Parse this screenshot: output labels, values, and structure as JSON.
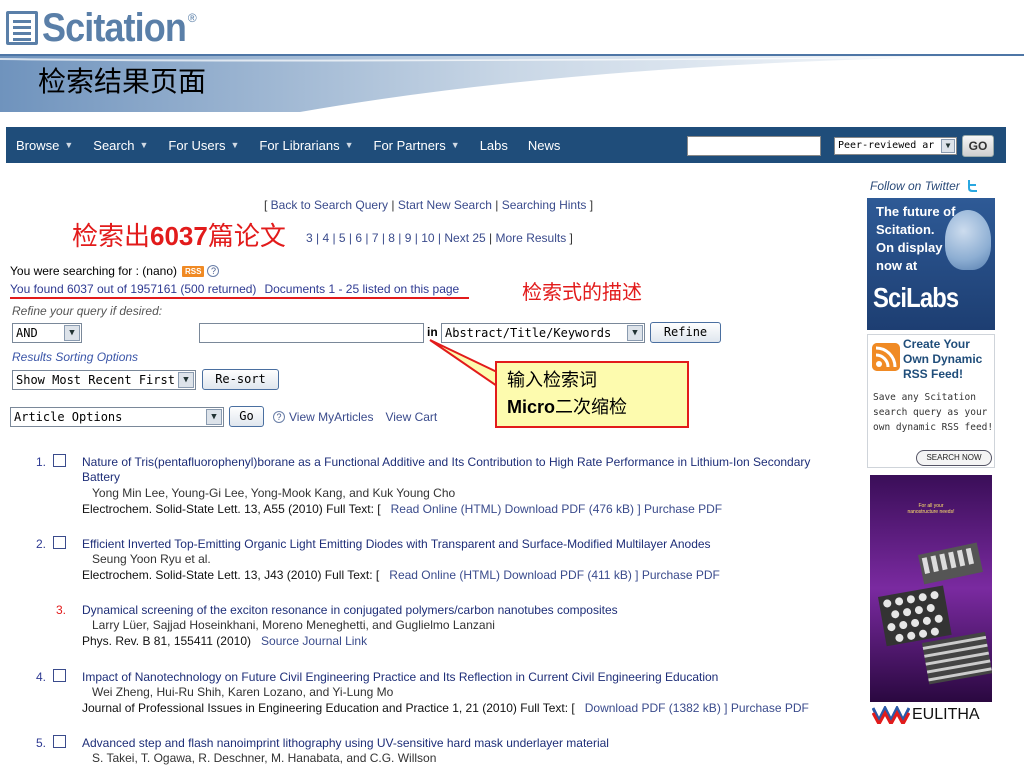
{
  "slide": {
    "logo_text": "Scitation",
    "logo_reg": "®",
    "title": "检索结果页面",
    "anno_found_prefix": "检索出",
    "anno_found_num": "6037",
    "anno_found_suffix": "篇论文",
    "anno_desc": "检索式的描述",
    "callout_line1": "输入检索词",
    "callout_line2_a": "Micro",
    "callout_line2_b": "二次缩检",
    "accent_color": "#e21b1b"
  },
  "navbar": {
    "items": [
      {
        "label": "Browse",
        "caret": true
      },
      {
        "label": "Search",
        "caret": true
      },
      {
        "label": "For Users",
        "caret": true
      },
      {
        "label": "For Librarians",
        "caret": true
      },
      {
        "label": "For Partners",
        "caret": true
      },
      {
        "label": "Labs",
        "caret": false
      },
      {
        "label": "News",
        "caret": false
      }
    ],
    "search_value": "",
    "scope_select": "Peer-reviewed ar",
    "go_label": "GO",
    "bg_color": "#1f4d7a"
  },
  "toplinks": {
    "open": "[ ",
    "back": "Back to Search Query",
    "start": "Start New Search",
    "hints": "Searching Hints",
    "close": " ]"
  },
  "pagelinks": {
    "visible": "3 | 4 | 5 | 6 | 7 | 8 | 9 | 10 | ",
    "next": "Next 25",
    "more": "More Results",
    "close": " ]"
  },
  "search_info": {
    "searching_for": "You were searching for : (nano)",
    "rss": "RSS",
    "help": "?",
    "found": "You found 6037 out of 1957161 (500 returned)",
    "docs": "Documents 1 - 25 listed on this page",
    "refine_label": "Refine your query if desired:",
    "bool_select": "AND",
    "refine_value": "",
    "in_label": "in",
    "field_select": "Abstract/Title/Keywords",
    "refine_btn": "Refine",
    "sort_label": "Results Sorting Options",
    "sort_select": "Show Most Recent First",
    "resort_btn": "Re-sort",
    "article_select": "Article Options",
    "go_btn": "Go",
    "view_myarticles": "View MyArticles",
    "view_cart": "View Cart"
  },
  "results": [
    {
      "num": "1.",
      "checkbox": true,
      "title": "Nature of Tris(pentafluorophenyl)borane as a Functional Additive and Its Contribution to High Rate Performance in Lithium-Ion Secondary Battery",
      "authors": "Yong Min Lee, Young-Gi Lee, Yong-Mook Kang, and Kuk Young Cho",
      "cite": "Electrochem. Solid-State Lett. 13, A55 (2010)  Full Text: [",
      "links": "Read Online (HTML)   Download PDF (476 kB) ]   Purchase PDF"
    },
    {
      "num": "2.",
      "checkbox": true,
      "title": "Efficient Inverted Top-Emitting Organic Light Emitting Diodes with Transparent and Surface-Modified Multilayer Anodes",
      "authors": "Seung Yoon Ryu et al.",
      "cite": "Electrochem. Solid-State Lett. 13, J43 (2010)  Full Text: [",
      "links": "Read Online (HTML)   Download PDF (411 kB) ]   Purchase PDF"
    },
    {
      "num": "3.",
      "checkbox": false,
      "title": "Dynamical screening of the exciton resonance in conjugated polymers/carbon nanotubes composites",
      "authors": "Larry Lüer, Sajjad Hoseinkhani, Moreno Meneghetti, and Guglielmo Lanzani",
      "cite": "Phys. Rev. B 81, 155411 (2010)",
      "links": "Source Journal Link"
    },
    {
      "num": "4.",
      "checkbox": true,
      "title": "Impact of Nanotechnology on Future Civil Engineering Practice and Its Reflection in Current Civil Engineering Education",
      "authors": "Wei Zheng, Hui-Ru Shih, Karen Lozano, and Yi-Lung Mo",
      "cite": "Journal of Professional Issues in Engineering Education and Practice 1, 21 (2010)  Full Text: [",
      "links": "Download PDF (1382 kB) ]   Purchase PDF"
    },
    {
      "num": "5.",
      "checkbox": true,
      "title": "Advanced step and flash nanoimprint lithography using UV-sensitive hard mask underlayer material",
      "authors": "S. Takei, T. Ogawa, R. Deschner, M. Hanabata, and C.G. Willson",
      "cite": "",
      "links": ""
    }
  ],
  "sidebar": {
    "twitter": "Follow on Twitter",
    "scilabs_text": "The future of Scitation. On display now at",
    "scilabs_logo": "SciLabs",
    "rss_head": "Create Your Own Dynamic RSS Feed!",
    "rss_desc": "Save any Scitation search query as your own dynamic RSS feed!",
    "rss_btn": "SEARCH NOW",
    "ad_tag": "For all your nanostructure needs!",
    "eulitha": "EULITHA"
  }
}
